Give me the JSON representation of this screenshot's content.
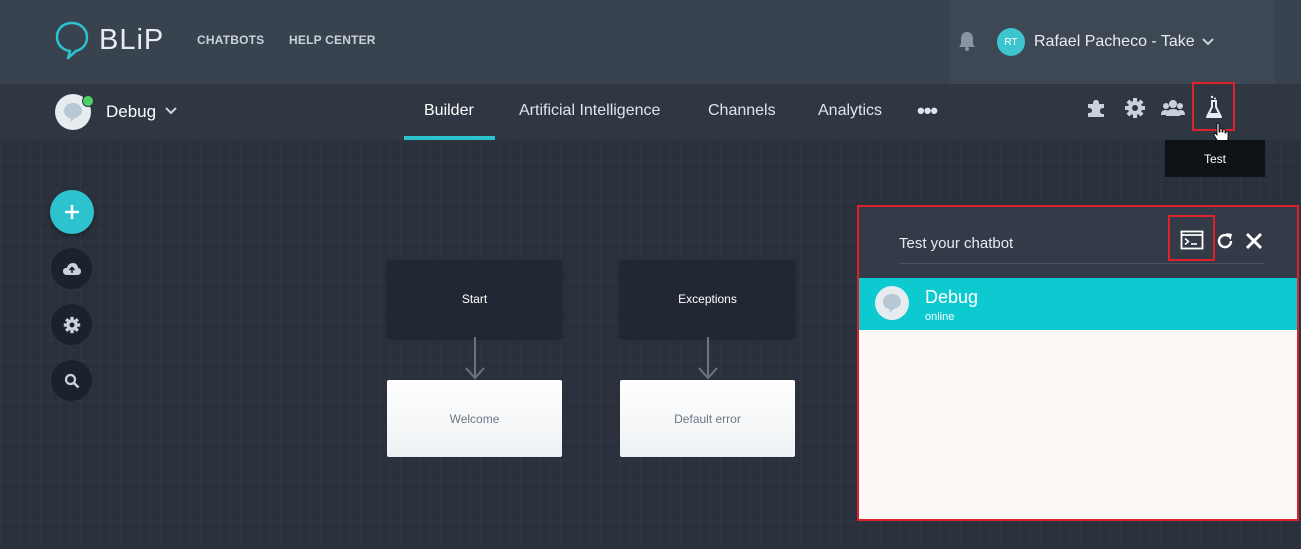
{
  "app": {
    "logo_text": "BLiP"
  },
  "topnav": {
    "chatbots": "CHATBOTS",
    "help_center": "HELP CENTER"
  },
  "user": {
    "initials": "RT",
    "name": "Rafael Pacheco - Take"
  },
  "bot": {
    "name": "Debug"
  },
  "tabs": [
    {
      "label": "Builder",
      "active": true
    },
    {
      "label": "Artificial Intelligence",
      "active": false
    },
    {
      "label": "Channels",
      "active": false
    },
    {
      "label": "Analytics",
      "active": false
    }
  ],
  "more": "•••",
  "toolbar": {
    "icons": [
      "puzzle-icon",
      "gear-icon",
      "users-icon",
      "flask-icon"
    ],
    "tooltip": "Test"
  },
  "sidebar": {
    "buttons": [
      "add",
      "cloud-upload",
      "settings",
      "search"
    ]
  },
  "flow": {
    "blocks": [
      {
        "label": "Start",
        "style": "dark"
      },
      {
        "label": "Welcome",
        "style": "light"
      },
      {
        "label": "Exceptions",
        "style": "dark"
      },
      {
        "label": "Default error",
        "style": "light"
      }
    ]
  },
  "test_panel": {
    "title": "Test your chatbot",
    "bot_name": "Debug",
    "bot_status": "online"
  },
  "colors": {
    "accent": "#2cc3cf",
    "chat_header": "#0ccad0",
    "highlight": "#e0202a"
  }
}
